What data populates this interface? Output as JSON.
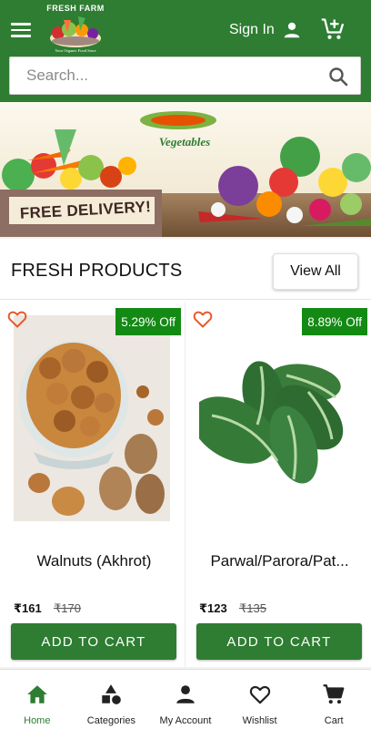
{
  "header": {
    "logo_title": "FRESH FARM",
    "logo_tagline": "Your Organic Food Store",
    "signin_label": "Sign In"
  },
  "search": {
    "placeholder": "Search..."
  },
  "banner": {
    "title_line": "Vegetables",
    "delivery_text": "FREE DELIVERY!"
  },
  "section": {
    "title": "FRESH PRODUCTS",
    "view_all_label": "View All"
  },
  "products": [
    {
      "name": "Walnuts (Akhrot)",
      "discount": "5.29% Off",
      "price": "₹161",
      "mrp": "₹170",
      "add_label": "ADD TO CART"
    },
    {
      "name": "Parwal/Parora/Pat...",
      "discount": "8.89% Off",
      "price": "₹123",
      "mrp": "₹135",
      "add_label": "ADD TO CART"
    }
  ],
  "bottom_nav": [
    {
      "label": "Home",
      "icon": "home-icon",
      "active": true
    },
    {
      "label": "Categories",
      "icon": "categories-icon",
      "active": false
    },
    {
      "label": "My Account",
      "icon": "account-icon",
      "active": false
    },
    {
      "label": "Wishlist",
      "icon": "heart-icon",
      "active": false
    },
    {
      "label": "Cart",
      "icon": "cart-icon",
      "active": false
    }
  ],
  "colors": {
    "primary_green": "#2e7d32",
    "badge_green": "#138a14",
    "wishlist_orange": "#e8582a"
  }
}
